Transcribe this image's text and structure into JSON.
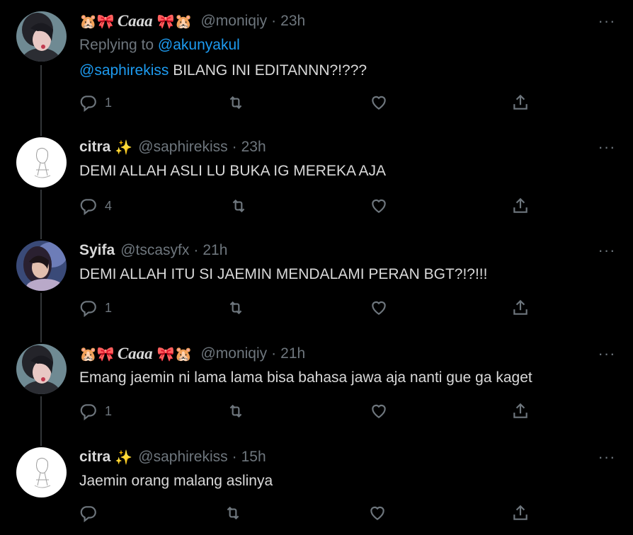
{
  "tweets": [
    {
      "name_pre": "🐹🎀",
      "name": "Caaa",
      "name_post": "🎀🐹",
      "handle": "@moniqiy",
      "time": "23h",
      "replying_label": "Replying to",
      "replying_to": "@akunyakul",
      "mention": "@saphirekiss",
      "text": " BILANG INI EDITANNN?!???",
      "reply_count": "1"
    },
    {
      "name": "citra",
      "name_emoji": "✨",
      "handle": "@saphirekiss",
      "time": "23h",
      "text": "DEMI ALLAH ASLI LU BUKA IG MEREKA AJA",
      "reply_count": "4"
    },
    {
      "name": "Syifa",
      "handle": "@tscasyfx",
      "time": "21h",
      "text": "DEMI ALLAH ITU SI JAEMIN MENDALAMI PERAN BGT?!?!!!",
      "reply_count": "1"
    },
    {
      "name_pre": "🐹🎀",
      "name": "Caaa",
      "name_post": "🎀🐹",
      "handle": "@moniqiy",
      "time": "21h",
      "text": "Emang jaemin ni lama lama bisa bahasa jawa aja nanti gue ga kaget",
      "reply_count": "1"
    },
    {
      "name": "citra",
      "name_emoji": "✨",
      "handle": "@saphirekiss",
      "time": "15h",
      "text": "Jaemin orang malang aslinya",
      "reply_count": ""
    }
  ],
  "icons": {
    "reply": "reply-icon",
    "retweet": "retweet-icon",
    "like": "heart-icon",
    "share": "share-icon",
    "more": "more-icon"
  },
  "colors": {
    "background": "#000000",
    "text": "#d9d9d9",
    "muted": "#6e767d",
    "link": "#1d9bf0"
  }
}
